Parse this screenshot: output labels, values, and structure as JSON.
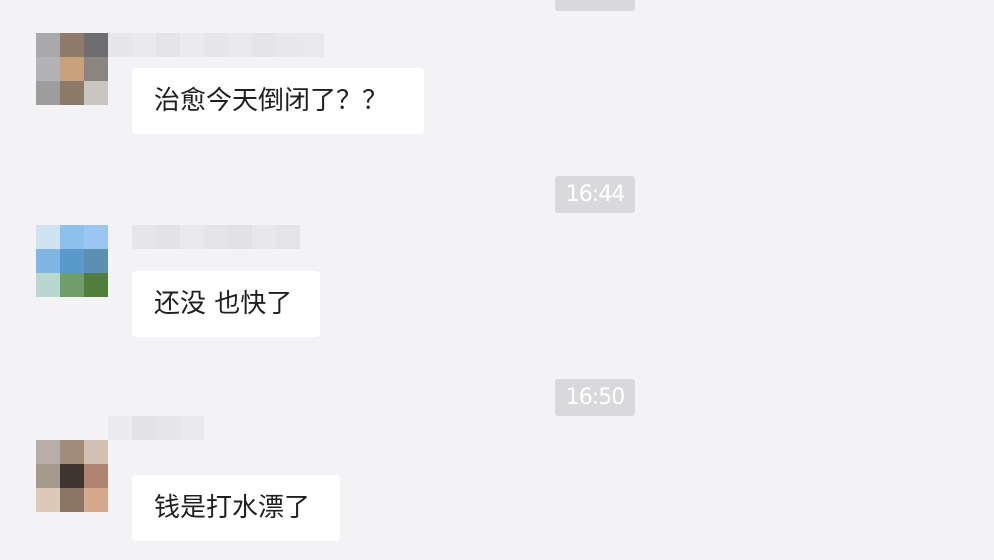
{
  "conversation": {
    "top_timestamp": "",
    "messages": [
      {
        "text": "治愈今天倒闭了？？",
        "avatar_colors": [
          "#a9a9ab",
          "#8f7b6a",
          "#6e6e70",
          "#b3b3b5",
          "#c9a27c",
          "#8a8580",
          "#9e9d9c",
          "#8c7a69",
          "#c9c5c0"
        ],
        "nickname_colors": [
          "#e7e7e9",
          "#eaeaec",
          "#e4e4e6",
          "#ebebed",
          "#e6e6e8",
          "#e9e9eb",
          "#e5e5e7",
          "#e8e8ea",
          "#e9e9eb"
        ]
      },
      {
        "timestamp": "16:44",
        "text": "还没 也快了",
        "avatar_colors": [
          "#cfe3f0",
          "#8dc0ea",
          "#9ac7f2",
          "#7fb6e3",
          "#5a9acb",
          "#5d8fb2",
          "#b9d6cf",
          "#6f9e67",
          "#4f7f3a"
        ],
        "nickname_colors": [
          "#e6e6e8",
          "#e3e3e5",
          "#e9e9eb",
          "#e5e5e7",
          "#e2e2e4",
          "#e8e8ea",
          "#e4e4e6"
        ]
      },
      {
        "timestamp": "16:50",
        "text": "钱是打水漂了",
        "avatar_colors": [
          "#b7aea5",
          "#a28b78",
          "#d3c2b4",
          "#a6998c",
          "#3e3530",
          "#b08270",
          "#dcc9b8",
          "#8a7565",
          "#d6a98c"
        ],
        "nickname_colors": [
          "#ececee",
          "#e3e3e5",
          "#e6e6e8",
          "#e9e9eb"
        ]
      }
    ]
  }
}
